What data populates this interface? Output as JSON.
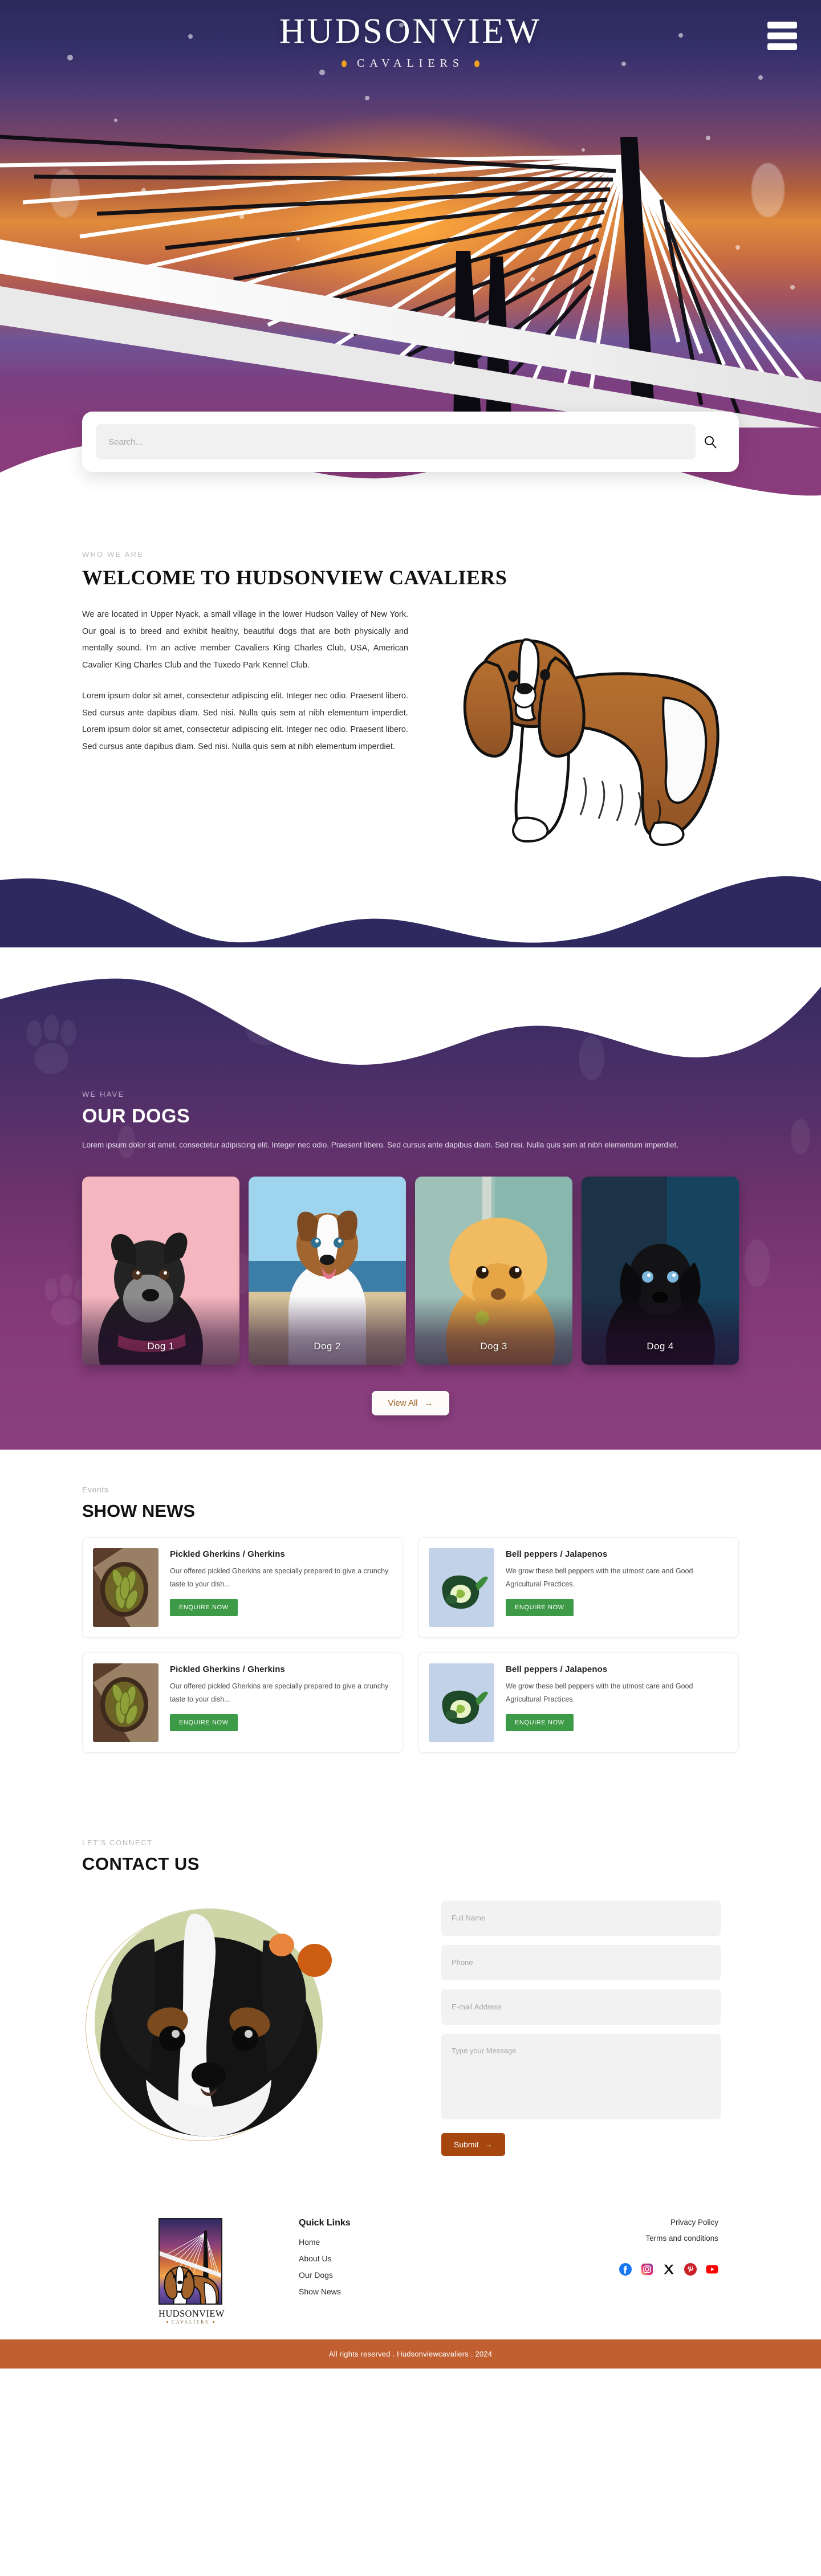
{
  "brand": {
    "name": "HUDSONVIEW",
    "tagline": "CAVALIERS"
  },
  "header": {
    "menu_label": "menu"
  },
  "search": {
    "placeholder": "Search...",
    "value": ""
  },
  "welcome": {
    "eyebrow": "WHO WE ARE",
    "title": "WELCOME TO HUDSONVIEW CAVALIERS",
    "paragraph1": "We are located in Upper Nyack, a small village in the lower Hudson Valley of New York.  Our goal is to breed and exhibit healthy, beautiful dogs that are both physically and mentally sound.   I'm an active member Cavaliers King Charles Club, USA, American Cavalier King Charles Club and the Tuxedo Park Kennel Club.",
    "paragraph2": "Lorem ipsum dolor sit amet, consectetur adipiscing elit. Integer nec odio. Praesent libero. Sed cursus ante dapibus diam. Sed nisi. Nulla quis sem at nibh elementum imperdiet. Lorem ipsum dolor sit amet, consectetur adipiscing elit. Integer nec odio. Praesent libero. Sed cursus ante dapibus diam. Sed nisi. Nulla quis sem at nibh elementum imperdiet."
  },
  "dogs": {
    "eyebrow": "WE HAVE",
    "title": "OUR DOGS",
    "description": "Lorem ipsum dolor sit amet, consectetur adipiscing elit. Integer nec odio. Praesent libero. Sed cursus ante dapibus diam. Sed nisi. Nulla quis sem at nibh elementum imperdiet.",
    "cards": [
      {
        "label": "Dog 1"
      },
      {
        "label": "Dog 2"
      },
      {
        "label": "Dog 3"
      },
      {
        "label": "Dog 4"
      }
    ],
    "view_all_label": "View All",
    "view_all_arrow": "→"
  },
  "news": {
    "eyebrow": "Events",
    "title": "SHOW NEWS",
    "cards": [
      {
        "title": "Pickled Gherkins / Gherkins",
        "text": "Our offered pickled Gherkins are specially prepared to give a crunchy taste to your dish...",
        "button": "ENQUIRE NOW"
      },
      {
        "title": "Bell peppers / Jalapenos",
        "text": "We grow these bell peppers with the utmost care and Good Agricultural Practices.",
        "button": "ENQUIRE NOW"
      },
      {
        "title": "Pickled Gherkins / Gherkins",
        "text": "Our offered pickled Gherkins are specially prepared to give a crunchy taste to your dish...",
        "button": "ENQUIRE NOW"
      },
      {
        "title": "Bell peppers / Jalapenos",
        "text": "We grow these bell peppers with the utmost care and Good Agricultural Practices.",
        "button": "ENQUIRE NOW"
      }
    ]
  },
  "contact": {
    "eyebrow": "LET'S CONNECT",
    "title": "CONTACT US",
    "fields": {
      "name_placeholder": "Full Name",
      "name_value": "",
      "phone_placeholder": "Phone",
      "phone_value": "",
      "email_placeholder": "E-mail Address",
      "email_value": "",
      "message_placeholder": "Type your Message",
      "message_value": ""
    },
    "submit_label": "Submit",
    "submit_arrow": "→"
  },
  "footer": {
    "logo_name": "HUDSONVIEW",
    "logo_sub": "CAVALIERS",
    "quick_links_title": "Quick Links",
    "quick_links": [
      {
        "label": "Home"
      },
      {
        "label": "About Us"
      },
      {
        "label": "Our Dogs"
      },
      {
        "label": "Show News"
      }
    ],
    "legal": [
      {
        "label": "Privacy Policy"
      },
      {
        "label": "Terms and conditions"
      }
    ],
    "socials": [
      {
        "name": "facebook-icon"
      },
      {
        "name": "instagram-icon"
      },
      {
        "name": "x-twitter-icon"
      },
      {
        "name": "pinterest-icon"
      },
      {
        "name": "youtube-icon"
      }
    ],
    "copyright": "All rights reserved . Hudsonviewcavaliers . 2024"
  },
  "colors": {
    "accent_orange": "#c15f30",
    "brand_gold": "#f0a01e",
    "purple": "#8a3f7f",
    "navy": "#2e2a60",
    "green": "#3d9a47",
    "submit_brown": "#a5470f"
  }
}
